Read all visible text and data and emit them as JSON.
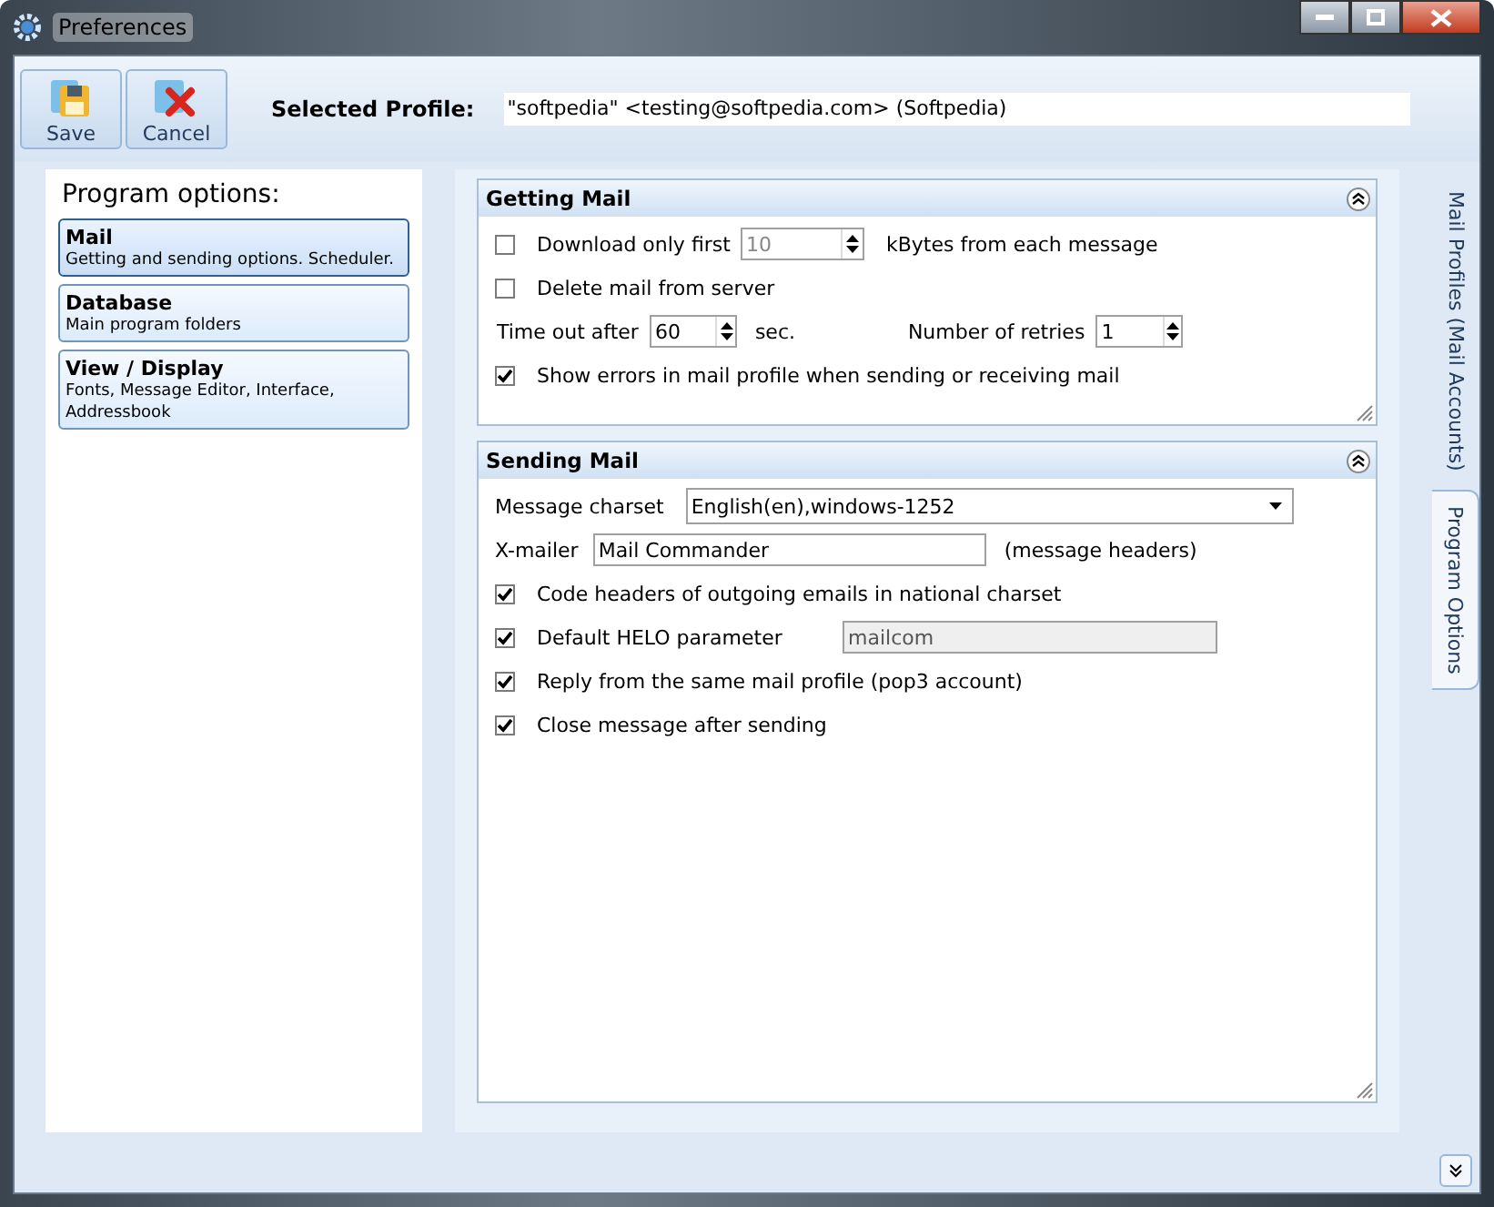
{
  "window": {
    "title": "Preferences"
  },
  "toolbar": {
    "buttons": [
      {
        "kind": "save",
        "label": "Save"
      },
      {
        "kind": "cancel",
        "label": "Cancel"
      }
    ],
    "profile_label": "Selected Profile:",
    "profile_value": "\"softpedia\" <testing@softpedia.com> (Softpedia)"
  },
  "sidebar": {
    "title": "Program options:",
    "items": [
      {
        "title": "Mail",
        "description": "Getting and sending options. Scheduler.",
        "selected": true
      },
      {
        "title": "Database",
        "description": "Main program folders",
        "selected": false
      },
      {
        "title": "View / Display",
        "description": "Fonts, Message Editor, Interface, Addressbook",
        "selected": false
      }
    ]
  },
  "sections": [
    {
      "title": "Getting Mail",
      "rows": [
        {
          "kind": "checkbox-spin",
          "label": "Download only first",
          "checked": false,
          "value": "10",
          "disabled": true,
          "suffix": "kBytes from each message"
        },
        {
          "kind": "checkbox",
          "label": "Delete mail from server",
          "checked": false
        },
        {
          "kind": "spins",
          "label": "Time out after",
          "value": "60",
          "suffix": "sec.",
          "label2": "Number of retries",
          "value2": "1"
        },
        {
          "kind": "checkbox",
          "label": "Show errors in mail profile when sending or receiving mail",
          "checked": true
        }
      ]
    },
    {
      "title": "Sending Mail",
      "rows": [
        {
          "kind": "select",
          "label": "Message charset",
          "value": "English(en),windows-1252"
        },
        {
          "kind": "text",
          "label": "X-mailer",
          "value": "Mail Commander",
          "suffix": "(message headers)"
        },
        {
          "kind": "checkbox",
          "label": "Code headers of outgoing emails in national charset",
          "checked": true
        },
        {
          "kind": "checkbox-text",
          "label": "Default HELO parameter",
          "checked": true,
          "value": "mailcom",
          "disabled": true
        },
        {
          "kind": "checkbox",
          "label": "Reply from the same mail profile (pop3 account)",
          "checked": true
        },
        {
          "kind": "checkbox",
          "label": "Close message after sending",
          "checked": true
        }
      ]
    }
  ],
  "side_tabs": [
    {
      "label": "Mail Profiles (Mail Accounts)",
      "selected": false
    },
    {
      "label": "Program Options",
      "selected": true
    }
  ]
}
